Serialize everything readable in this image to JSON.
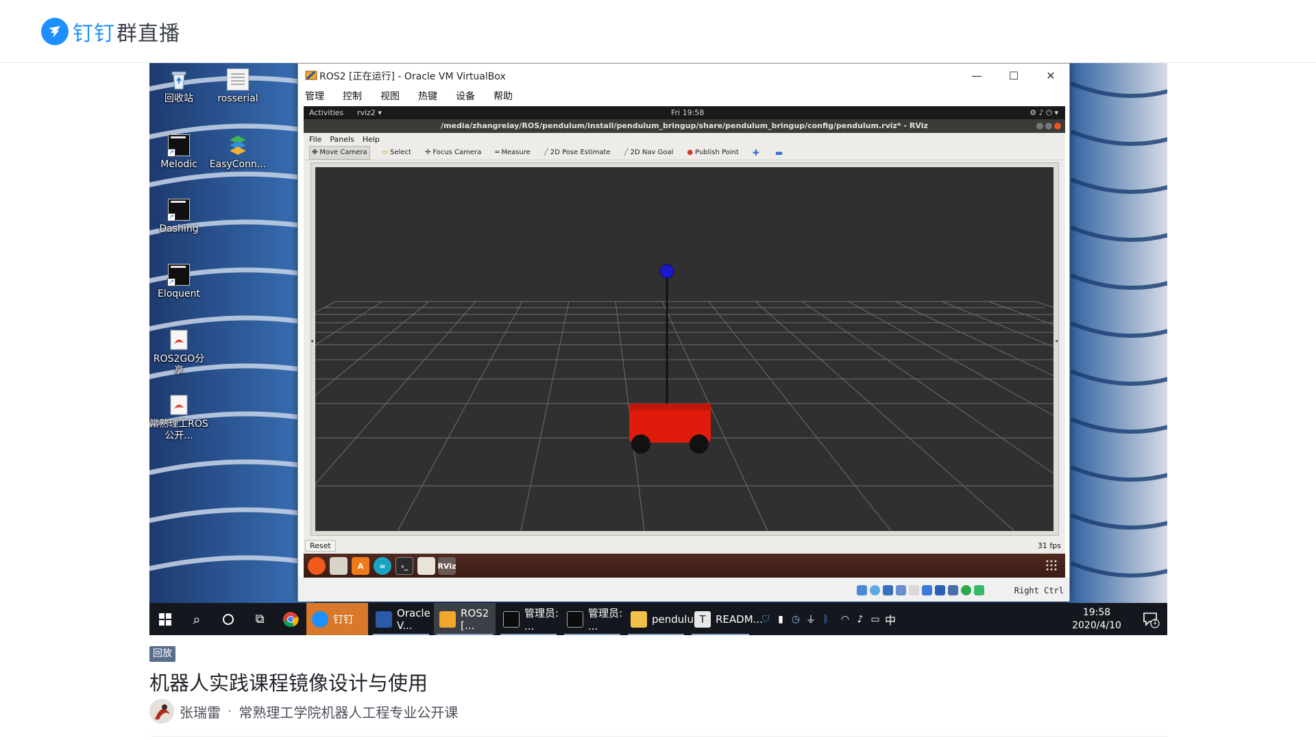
{
  "header": {
    "brand": "钉钉",
    "product": "群直播",
    "logo_icon": "dingtalk-logo-icon",
    "brand_color": "#1e8fff"
  },
  "video": {
    "desktop_icons": [
      {
        "label": "回收站",
        "icon": "recycle-bin-icon"
      },
      {
        "label": "rosserial",
        "icon": "document-icon"
      },
      {
        "label": "Melodic",
        "icon": "terminal-shortcut-icon"
      },
      {
        "label": "EasyConn...",
        "icon": "easyconnect-icon"
      },
      {
        "label": "Dashing",
        "icon": "terminal-shortcut-icon"
      },
      {
        "label": "Eloquent",
        "icon": "terminal-shortcut-icon"
      },
      {
        "label": "ROS2GO分享",
        "icon": "pdf-shortcut-icon"
      },
      {
        "label": "常熟理工ROS公开...",
        "icon": "pdf-shortcut-icon"
      }
    ],
    "vbox": {
      "title": "ROS2 [正在运行] - Oracle VM VirtualBox",
      "menu": [
        "管理",
        "控制",
        "视图",
        "热键",
        "设备",
        "帮助"
      ],
      "host_key": "Right Ctrl"
    },
    "guest": {
      "activities": "Activities",
      "app_menu": "rviz2 ▾",
      "clock": "Fri 19:58",
      "window_title": "/media/zhangrelay/ROS/pendulum/install/pendulum_bringup/share/pendulum_bringup/config/pendulum.rviz* - RViz",
      "menu": [
        "File",
        "Panels",
        "Help"
      ],
      "tools": [
        {
          "label": "Move Camera",
          "icon": "move-camera-icon",
          "active": true
        },
        {
          "label": "Select",
          "icon": "select-icon"
        },
        {
          "label": "Focus Camera",
          "icon": "focus-camera-icon"
        },
        {
          "label": "Measure",
          "icon": "measure-icon"
        },
        {
          "label": "2D Pose Estimate",
          "icon": "pose-estimate-icon"
        },
        {
          "label": "2D Nav Goal",
          "icon": "nav-goal-icon"
        },
        {
          "label": "Publish Point",
          "icon": "publish-point-icon"
        }
      ],
      "reset_label": "Reset",
      "fps": "31 fps",
      "dock_rviz_label": "RViz"
    },
    "taskbar": {
      "apps": [
        {
          "label": "钉钉",
          "icon": "dingtalk-icon"
        },
        {
          "label": "Oracle V...",
          "icon": "virtualbox-icon"
        },
        {
          "label": "ROS2 [...",
          "icon": "virtualbox-vm-icon"
        },
        {
          "label": "管理员: ...",
          "icon": "cmd-icon"
        },
        {
          "label": "管理员: ...",
          "icon": "cmd-icon"
        },
        {
          "label": "pendulu...",
          "icon": "folder-icon"
        },
        {
          "label": "READM...",
          "icon": "typora-icon"
        }
      ],
      "ime": "中",
      "time": "19:58",
      "date": "2020/4/10",
      "notification_count": "1"
    }
  },
  "info": {
    "badge": "回放",
    "title": "机器人实践课程镜像设计与使用",
    "author": "张瑞雷",
    "separator": "·",
    "channel": "常熟理工学院机器人工程专业公开课"
  }
}
